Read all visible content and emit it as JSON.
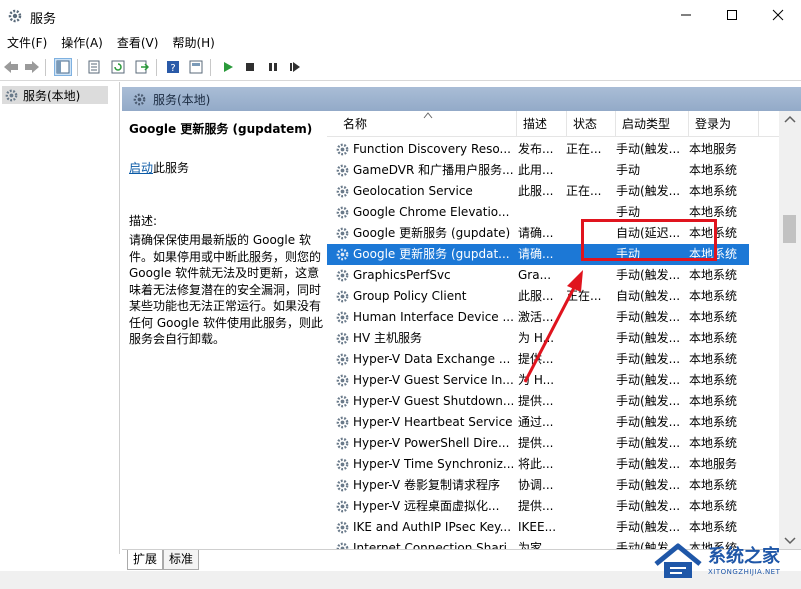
{
  "window": {
    "title": "服务"
  },
  "menu": [
    "文件(F)",
    "操作(A)",
    "查看(V)",
    "帮助(H)"
  ],
  "toolbar": {
    "icons": [
      "back-arrow-icon",
      "forward-arrow-icon",
      "show-tree-icon",
      "properties-icon",
      "refresh-icon",
      "export-icon",
      "help-icon",
      "panel-icon",
      "play-icon",
      "stop-icon",
      "pause-icon",
      "restart-icon"
    ]
  },
  "tree": {
    "root": "服务(本地)"
  },
  "pane": {
    "header": "服务(本地)"
  },
  "description": {
    "service_title": "Google 更新服务 (gupdatem)",
    "start_link": "启动",
    "start_suffix": "此服务",
    "label": "描述:",
    "body": "请确保保使用最新版的 Google 软件。如果停用或中断此服务，则您的 Google 软件就无法及时更新，这意味着无法修复潜在的安全漏洞，同时某些功能也无法正常运行。如果没有任何 Google 软件使用此服务，则此服务会自行卸载。"
  },
  "columns": {
    "name": "名称",
    "desc": "描述",
    "status": "状态",
    "startup": "启动类型",
    "logon": "登录为"
  },
  "services": [
    {
      "name": "Function Discovery Reso...",
      "desc": "发布...",
      "status": "正在...",
      "startup": "手动(触发...",
      "logon": "本地服务"
    },
    {
      "name": "GameDVR 和广播用户服务...",
      "desc": "此用...",
      "status": "",
      "startup": "手动",
      "logon": "本地系统"
    },
    {
      "name": "Geolocation Service",
      "desc": "此服...",
      "status": "正在...",
      "startup": "手动(触发...",
      "logon": "本地系统"
    },
    {
      "name": "Google Chrome Elevatio...",
      "desc": "",
      "status": "",
      "startup": "手动",
      "logon": "本地系统"
    },
    {
      "name": "Google 更新服务 (gupdate)",
      "desc": "请确...",
      "status": "",
      "startup": "自动(延迟...",
      "logon": "本地系统"
    },
    {
      "name": "Google 更新服务 (gupdat...",
      "desc": "请确...",
      "status": "",
      "startup": "手动",
      "logon": "本地系统",
      "selected": true
    },
    {
      "name": "GraphicsPerfSvc",
      "desc": "Gra...",
      "status": "",
      "startup": "手动(触发...",
      "logon": "本地系统"
    },
    {
      "name": "Group Policy Client",
      "desc": "此服...",
      "status": "正在...",
      "startup": "自动(触发...",
      "logon": "本地系统"
    },
    {
      "name": "Human Interface Device ...",
      "desc": "激活...",
      "status": "",
      "startup": "手动(触发...",
      "logon": "本地系统"
    },
    {
      "name": "HV 主机服务",
      "desc": "为 H...",
      "status": "",
      "startup": "手动(触发...",
      "logon": "本地系统"
    },
    {
      "name": "Hyper-V Data Exchange ...",
      "desc": "提供...",
      "status": "",
      "startup": "手动(触发...",
      "logon": "本地系统"
    },
    {
      "name": "Hyper-V Guest Service In...",
      "desc": "为 H...",
      "status": "",
      "startup": "手动(触发...",
      "logon": "本地系统"
    },
    {
      "name": "Hyper-V Guest Shutdown...",
      "desc": "提供...",
      "status": "",
      "startup": "手动(触发...",
      "logon": "本地系统"
    },
    {
      "name": "Hyper-V Heartbeat Service",
      "desc": "通过...",
      "status": "",
      "startup": "手动(触发...",
      "logon": "本地系统"
    },
    {
      "name": "Hyper-V PowerShell Dire...",
      "desc": "提供...",
      "status": "",
      "startup": "手动(触发...",
      "logon": "本地系统"
    },
    {
      "name": "Hyper-V Time Synchroniz...",
      "desc": "将此...",
      "status": "",
      "startup": "手动(触发...",
      "logon": "本地服务"
    },
    {
      "name": "Hyper-V 卷影复制请求程序",
      "desc": "协调...",
      "status": "",
      "startup": "手动(触发...",
      "logon": "本地系统"
    },
    {
      "name": "Hyper-V 远程桌面虚拟化...",
      "desc": "提供...",
      "status": "",
      "startup": "手动(触发...",
      "logon": "本地系统"
    },
    {
      "name": "IKE and AuthIP IPsec Key...",
      "desc": "IKEE...",
      "status": "",
      "startup": "手动(触发...",
      "logon": "本地系统"
    },
    {
      "name": "Internet Connection Shari...",
      "desc": "为家...",
      "status": "",
      "startup": "手动(触发...",
      "logon": "本地系统"
    }
  ],
  "bottom_tabs": [
    "扩展",
    "标准"
  ],
  "watermark": {
    "name": "系统之家",
    "url": "XITONGZHIJIA.NET"
  },
  "colors": {
    "selection": "#1c78d6",
    "header_gradient": "#a9bdd6",
    "annotation": "#e0141e",
    "brand": "#1f57a8"
  }
}
